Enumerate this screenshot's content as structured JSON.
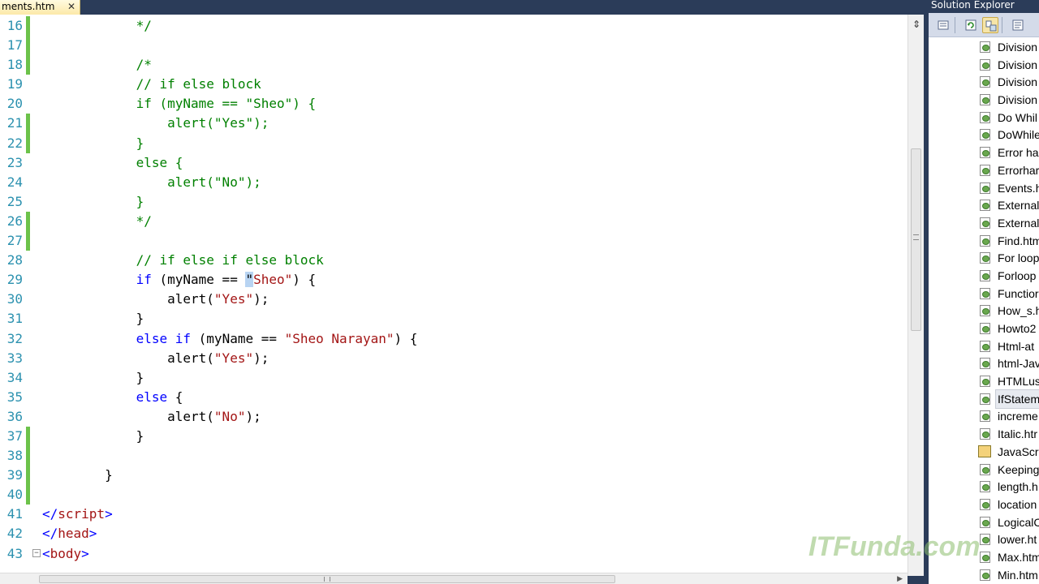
{
  "document_tab": {
    "label": "ments.htm",
    "close": "✕"
  },
  "editor": {
    "lines": [
      {
        "n": "16",
        "saved": true,
        "fold": "",
        "tokens": [
          [
            "plain",
            "            "
          ],
          [
            "comment",
            "*/"
          ]
        ]
      },
      {
        "n": "17",
        "saved": true,
        "fold": "",
        "tokens": []
      },
      {
        "n": "18",
        "saved": true,
        "fold": "",
        "tokens": [
          [
            "plain",
            "            "
          ],
          [
            "comment",
            "/*"
          ]
        ]
      },
      {
        "n": "19",
        "saved": false,
        "fold": "",
        "tokens": [
          [
            "plain",
            "            "
          ],
          [
            "comment",
            "// if else block"
          ]
        ]
      },
      {
        "n": "20",
        "saved": false,
        "fold": "",
        "tokens": [
          [
            "plain",
            "            "
          ],
          [
            "comment",
            "if (myName == \"Sheo\") {"
          ]
        ]
      },
      {
        "n": "21",
        "saved": true,
        "fold": "",
        "tokens": [
          [
            "plain",
            "                "
          ],
          [
            "comment",
            "alert(\"Yes\");"
          ]
        ]
      },
      {
        "n": "22",
        "saved": true,
        "fold": "",
        "tokens": [
          [
            "plain",
            "            "
          ],
          [
            "comment",
            "}"
          ]
        ]
      },
      {
        "n": "23",
        "saved": false,
        "fold": "",
        "tokens": [
          [
            "plain",
            "            "
          ],
          [
            "comment",
            "else {"
          ]
        ]
      },
      {
        "n": "24",
        "saved": false,
        "fold": "",
        "tokens": [
          [
            "plain",
            "                "
          ],
          [
            "comment",
            "alert(\"No\");"
          ]
        ]
      },
      {
        "n": "25",
        "saved": false,
        "fold": "",
        "tokens": [
          [
            "plain",
            "            "
          ],
          [
            "comment",
            "}"
          ]
        ]
      },
      {
        "n": "26",
        "saved": true,
        "fold": "",
        "tokens": [
          [
            "plain",
            "            "
          ],
          [
            "comment",
            "*/"
          ]
        ]
      },
      {
        "n": "27",
        "saved": true,
        "fold": "",
        "tokens": []
      },
      {
        "n": "28",
        "saved": false,
        "fold": "",
        "tokens": [
          [
            "plain",
            "            "
          ],
          [
            "comment",
            "// if else if else block"
          ]
        ]
      },
      {
        "n": "29",
        "saved": false,
        "fold": "",
        "tokens": [
          [
            "plain",
            "            "
          ],
          [
            "keyword",
            "if"
          ],
          [
            "plain",
            " (myName == "
          ],
          [
            "sel",
            "\""
          ],
          [
            "string",
            "Sheo\""
          ],
          [
            "plain",
            ") {"
          ]
        ]
      },
      {
        "n": "30",
        "saved": false,
        "fold": "",
        "tokens": [
          [
            "plain",
            "                alert("
          ],
          [
            "string",
            "\"Yes\""
          ],
          [
            "plain",
            ");"
          ]
        ]
      },
      {
        "n": "31",
        "saved": false,
        "fold": "",
        "tokens": [
          [
            "plain",
            "            }"
          ]
        ]
      },
      {
        "n": "32",
        "saved": false,
        "fold": "",
        "tokens": [
          [
            "plain",
            "            "
          ],
          [
            "keyword",
            "else if"
          ],
          [
            "plain",
            " (myName == "
          ],
          [
            "string",
            "\"Sheo Narayan\""
          ],
          [
            "plain",
            ") {"
          ]
        ]
      },
      {
        "n": "33",
        "saved": false,
        "fold": "",
        "tokens": [
          [
            "plain",
            "                alert("
          ],
          [
            "string",
            "\"Yes\""
          ],
          [
            "plain",
            ");"
          ]
        ]
      },
      {
        "n": "34",
        "saved": false,
        "fold": "",
        "tokens": [
          [
            "plain",
            "            }"
          ]
        ]
      },
      {
        "n": "35",
        "saved": false,
        "fold": "",
        "tokens": [
          [
            "plain",
            "            "
          ],
          [
            "keyword",
            "else"
          ],
          [
            "plain",
            " {"
          ]
        ]
      },
      {
        "n": "36",
        "saved": false,
        "fold": "",
        "tokens": [
          [
            "plain",
            "                alert("
          ],
          [
            "string",
            "\"No\""
          ],
          [
            "plain",
            ");"
          ]
        ]
      },
      {
        "n": "37",
        "saved": true,
        "fold": "",
        "tokens": [
          [
            "plain",
            "            }"
          ]
        ]
      },
      {
        "n": "38",
        "saved": true,
        "fold": "",
        "tokens": []
      },
      {
        "n": "39",
        "saved": true,
        "fold": "",
        "tokens": [
          [
            "plain",
            "        }"
          ]
        ]
      },
      {
        "n": "40",
        "saved": true,
        "fold": "",
        "tokens": []
      },
      {
        "n": "41",
        "saved": false,
        "fold": "",
        "tokens": [
          [
            "punct",
            "</"
          ],
          [
            "tag",
            "script"
          ],
          [
            "punct",
            ">"
          ]
        ]
      },
      {
        "n": "42",
        "saved": false,
        "fold": "",
        "tokens": [
          [
            "punct",
            "</"
          ],
          [
            "tag",
            "head"
          ],
          [
            "punct",
            ">"
          ]
        ]
      },
      {
        "n": "43",
        "saved": false,
        "fold": "−",
        "tokens": [
          [
            "punct",
            "<"
          ],
          [
            "tag",
            "body"
          ],
          [
            "punct",
            ">"
          ]
        ]
      }
    ]
  },
  "solution_explorer": {
    "title": "Solution Explorer",
    "toolbar_icons": [
      "properties-icon",
      "refresh-icon",
      "nest-files-icon",
      "view-code-icon"
    ],
    "items": [
      {
        "label": "Division",
        "icon": "html-file-icon",
        "selected": false
      },
      {
        "label": "Division",
        "icon": "html-file-icon",
        "selected": false
      },
      {
        "label": "Division",
        "icon": "html-file-icon",
        "selected": false
      },
      {
        "label": "Division",
        "icon": "html-file-icon",
        "selected": false
      },
      {
        "label": "Do Whil",
        "icon": "html-file-icon",
        "selected": false
      },
      {
        "label": "DoWhile",
        "icon": "html-file-icon",
        "selected": false
      },
      {
        "label": "Error ha",
        "icon": "html-file-icon",
        "selected": false
      },
      {
        "label": "Errorhar",
        "icon": "html-file-icon",
        "selected": false
      },
      {
        "label": "Events.h",
        "icon": "html-file-icon",
        "selected": false
      },
      {
        "label": "External.",
        "icon": "html-file-icon",
        "selected": false
      },
      {
        "label": "External.",
        "icon": "html-file-icon",
        "selected": false
      },
      {
        "label": "Find.htm",
        "icon": "html-file-icon",
        "selected": false
      },
      {
        "label": "For loop",
        "icon": "html-file-icon",
        "selected": false
      },
      {
        "label": "Forloop",
        "icon": "html-file-icon",
        "selected": false
      },
      {
        "label": "Functior",
        "icon": "html-file-icon",
        "selected": false
      },
      {
        "label": "How_s.h",
        "icon": "html-file-icon",
        "selected": false
      },
      {
        "label": "Howto2",
        "icon": "html-file-icon",
        "selected": false
      },
      {
        "label": "Html-at",
        "icon": "html-file-icon",
        "selected": false
      },
      {
        "label": "html-Jav",
        "icon": "html-file-icon",
        "selected": false
      },
      {
        "label": "HTMLus",
        "icon": "html-file-icon",
        "selected": false
      },
      {
        "label": "IfStatem",
        "icon": "html-file-icon",
        "selected": true
      },
      {
        "label": "increme",
        "icon": "html-file-icon",
        "selected": false
      },
      {
        "label": "Italic.htr",
        "icon": "html-file-icon",
        "selected": false
      },
      {
        "label": "JavaScri",
        "icon": "js-file-icon",
        "selected": false
      },
      {
        "label": "Keeping",
        "icon": "html-file-icon",
        "selected": false
      },
      {
        "label": "length.h",
        "icon": "html-file-icon",
        "selected": false
      },
      {
        "label": "location",
        "icon": "html-file-icon",
        "selected": false
      },
      {
        "label": "LogicalC",
        "icon": "html-file-icon",
        "selected": false
      },
      {
        "label": "lower.ht",
        "icon": "html-file-icon",
        "selected": false
      },
      {
        "label": "Max.htm",
        "icon": "html-file-icon",
        "selected": false
      },
      {
        "label": "Min.htm",
        "icon": "html-file-icon",
        "selected": false
      }
    ]
  },
  "watermark": {
    "text": "ITFunda.com"
  },
  "colors": {
    "chrome": "#2b3c59",
    "comment": "#008000",
    "keyword": "#0000ff",
    "string": "#a31515",
    "line_number": "#2b91af",
    "change_marker": "#6cc24a"
  }
}
